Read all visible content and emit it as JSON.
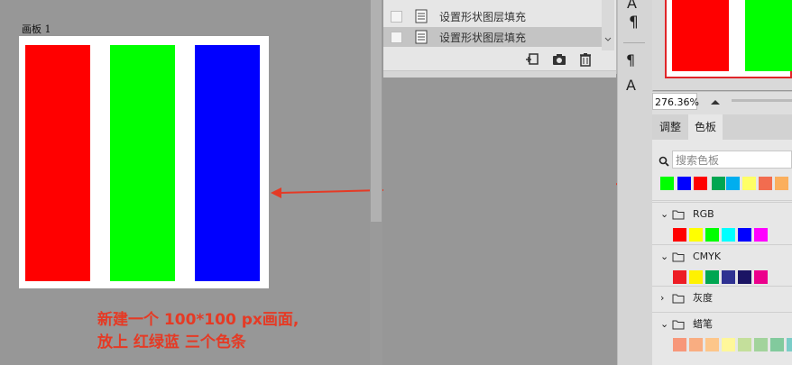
{
  "canvas": {
    "artboard_label": "画板 1",
    "bars": [
      {
        "name": "red",
        "color": "#ff0000"
      },
      {
        "name": "green",
        "color": "#00ff00"
      },
      {
        "name": "blue",
        "color": "#0000ff"
      }
    ],
    "annotation_line1": "新建一个 100*100 px画面,",
    "annotation_line2": "放上 红绿蓝 三个色条",
    "annotation_color": "#e53a25"
  },
  "layers": {
    "items": [
      {
        "label": "设置形状图层填充",
        "selected": false
      },
      {
        "label": "设置形状图层填充",
        "selected": true
      }
    ],
    "bottom_icons": [
      "new-snapshot-icon",
      "camera-icon",
      "trash-icon"
    ]
  },
  "tools": [
    "text-icon",
    "pilcrow-icon",
    "paragraph-style-icon",
    "character-style-icon"
  ],
  "navigator": {
    "zoom": "276.36%"
  },
  "panel_tabs": [
    {
      "label": "调整",
      "active": false
    },
    {
      "label": "色板",
      "active": true
    }
  ],
  "swatches": {
    "search_placeholder": "搜索色板",
    "recent": [
      "#00ff00",
      "#0000ff",
      "#ff0000",
      "#00a651",
      "#00aeef",
      "#ffff66",
      "#f26c4f",
      "#fbaf5d"
    ],
    "groups": [
      {
        "name": "RGB",
        "expanded": true,
        "colors": [
          "#ff0000",
          "#ffff00",
          "#00ff00",
          "#00ffff",
          "#0000ff",
          "#ff00ff"
        ]
      },
      {
        "name": "CMYK",
        "expanded": true,
        "colors": [
          "#ed1c24",
          "#fff200",
          "#00a651",
          "#2e3192",
          "#1b1464",
          "#ec008c"
        ]
      },
      {
        "name": "灰度",
        "expanded": false,
        "colors": []
      },
      {
        "name": "蜡笔",
        "expanded": true,
        "colors": [
          "#f7977a",
          "#f9ad81",
          "#fdc68a",
          "#fff79a",
          "#c4df9b",
          "#a2d39c",
          "#82ca9d",
          "#7bcdc8",
          "#6ecff6"
        ]
      }
    ]
  }
}
